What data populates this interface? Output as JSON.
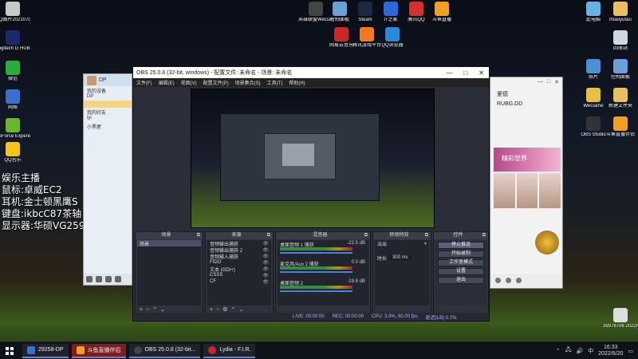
{
  "desktop_left_icons": [
    {
      "label": "QQ图片20210705...",
      "color": "#c9c9c9"
    },
    {
      "label": "Logitech G HUB",
      "color": "#1a2a6a"
    },
    {
      "label": "微信",
      "color": "#2aae3a"
    },
    {
      "label": "网络",
      "color": "#3a6fd0"
    },
    {
      "label": "GeForce Experience",
      "color": "#6ab82a"
    },
    {
      "label": "QQ音乐",
      "color": "#f5c518"
    }
  ],
  "desktop_top_icons": [
    {
      "label": "英雄联盟WeGame版",
      "color": "#444"
    },
    {
      "label": "控制面板",
      "color": "#6aa0d8"
    },
    {
      "label": "Steam",
      "color": "#1a2a44"
    },
    {
      "label": "IT之家",
      "color": "#2a6ad8"
    },
    {
      "label": "腾讯QQ",
      "color": "#d43030"
    },
    {
      "label": "斗鱼直播",
      "color": "#f0a020"
    },
    {
      "label": "网易云音乐",
      "color": "#c82828"
    },
    {
      "label": "腾讯游戏平台",
      "color": "#f07a20"
    },
    {
      "label": "QQ浏览器",
      "color": "#2a8ad8"
    }
  ],
  "desktop_right_icons": [
    {
      "label": "此电脑",
      "color": "#6ab0e8"
    },
    {
      "label": "miaoyutao",
      "color": "#e8c060"
    },
    {
      "label": "回收站",
      "color": "#cfd8e0"
    },
    {
      "label": "照片",
      "color": "#4a90d8"
    },
    {
      "label": "控制面板",
      "color": "#6aa0d8"
    },
    {
      "label": "WeGame",
      "color": "#e8c040"
    },
    {
      "label": "新建文件夹",
      "color": "#e8c060"
    },
    {
      "label": "OBS Studio",
      "color": "#333"
    },
    {
      "label": "斗鱼直播伴侣",
      "color": "#f0a020"
    },
    {
      "label": "39978706 2022/6/20",
      "color": "#ddd"
    }
  ],
  "overlay_text": [
    "娱乐主播",
    "鼠标:卓威EC2",
    "耳机:金士顿黑鹰S",
    "键盘:ikbcC87茶轴",
    "显示器:华硕VG259Q"
  ],
  "qq": {
    "title": "DP",
    "items": [
      "我的设备",
      "DP",
      "",
      "我的好友",
      "iyi",
      "小黑屋"
    ]
  },
  "music": {
    "username": "爱德",
    "subname": "RUBG.DD",
    "banner": "精彩世界"
  },
  "obs": {
    "title": "OBS 25.0.8 (32-bit, windows) - 配置文件: 未命名 - 场景: 未命名",
    "menu": [
      "文件(F)",
      "编辑(E)",
      "视图(V)",
      "配置文件(P)",
      "场景集合(S)",
      "工具(T)",
      "帮助(H)"
    ],
    "docks": {
      "scenes": "场景",
      "sources": "来源",
      "mixer": "混音器",
      "transitions": "转场特效",
      "controls": "控件"
    },
    "scene_items": [
      "场景"
    ],
    "source_items": [
      "音频输出捕获",
      "音频输出捕获 2",
      "音频输入捕获",
      "FIDO",
      "文本 (GDI+)",
      "CSSS",
      "CF"
    ],
    "mixer_rows": [
      {
        "name": "桌面音频 1 捕获",
        "db": "-22.5 dB"
      },
      {
        "name": "麦克风/Aux 2 捕获",
        "db": "0.0 dB"
      },
      {
        "name": "桌面音频 2",
        "db": "-19.8 dB"
      }
    ],
    "transition": {
      "type": "淡出",
      "duration_label": "时长",
      "duration": "300 ms"
    },
    "controls": [
      "停止推流",
      "开始录制",
      "工作室模式",
      "设置",
      "退出"
    ],
    "status": [
      "LIVE: 00:00:00",
      "REC: 00:00:00",
      "CPU: 3.9%, 60.00 fps",
      "延迟(LB) 0.7%"
    ]
  },
  "taskbar": {
    "items": [
      {
        "label": "29258-DP",
        "color": "#3a6fd0"
      },
      {
        "label": "斗鱼直播伴侣",
        "color": "#f0a020"
      },
      {
        "label": "OBS 25.0.8 (32-bit...",
        "color": "#333"
      },
      {
        "label": "Lydia - F.I.R.",
        "color": "#c82828"
      }
    ],
    "time": "16:33",
    "date": "2022/6/20",
    "lang": "中"
  }
}
